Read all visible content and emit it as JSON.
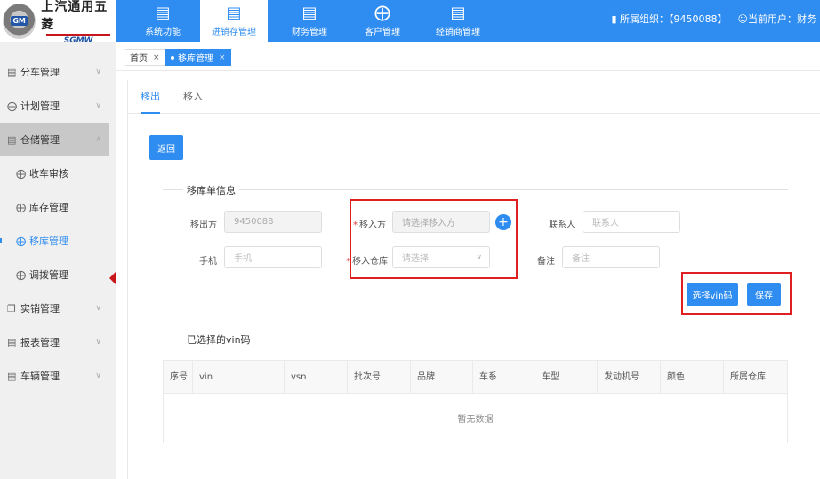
{
  "brand": {
    "name_cn": "上汽通用五菱",
    "name_en": "SGMW",
    "badge": "GM"
  },
  "topnav": {
    "items": [
      {
        "label": "系统功能",
        "icon": "server-icon"
      },
      {
        "label": "进销存管理",
        "icon": "server-icon",
        "active": true
      },
      {
        "label": "财务管理",
        "icon": "server-icon"
      },
      {
        "label": "客户管理",
        "icon": "grid-icon"
      },
      {
        "label": "经销商管理",
        "icon": "server-icon"
      }
    ],
    "org_label": "所属组织：【9450088】",
    "user_label": "当前用户：财务"
  },
  "sidebar": {
    "items": [
      {
        "label": "分车管理"
      },
      {
        "label": "计划管理"
      },
      {
        "label": "仓储管理"
      },
      {
        "label": "收车审核"
      },
      {
        "label": "库存管理"
      },
      {
        "label": "移库管理"
      },
      {
        "label": "调拨管理"
      },
      {
        "label": "实销管理"
      },
      {
        "label": "报表管理"
      },
      {
        "label": "车辆管理"
      }
    ]
  },
  "tabbar": {
    "home": "首页",
    "current": "移库管理",
    "close": "×"
  },
  "subtabs": {
    "out": "移出",
    "in": "移入"
  },
  "buttons": {
    "back": "返回",
    "select_vin": "选择vin码",
    "save": "保存"
  },
  "form": {
    "section_title": "移库单信息",
    "move_out_label": "移出方",
    "move_out_value": "9450088",
    "move_in_label": "移入方",
    "move_in_placeholder": "请选择移入方",
    "contact_label": "联系人",
    "contact_placeholder": "联系人",
    "phone_label": "手机",
    "phone_placeholder": "手机",
    "warehouse_label": "移入仓库",
    "warehouse_placeholder": "请选择",
    "remark_label": "备注",
    "remark_placeholder": "备注",
    "required_mark": "*"
  },
  "vin_section": {
    "title": "已选择的vin码",
    "columns": [
      "序号",
      "vin",
      "vsn",
      "批次号",
      "品牌",
      "车系",
      "车型",
      "发动机号",
      "颜色",
      "所属仓库"
    ],
    "empty_text": "暂无数据"
  },
  "colors": {
    "primary": "#2f8cf0",
    "highlight_box": "#e02020"
  }
}
